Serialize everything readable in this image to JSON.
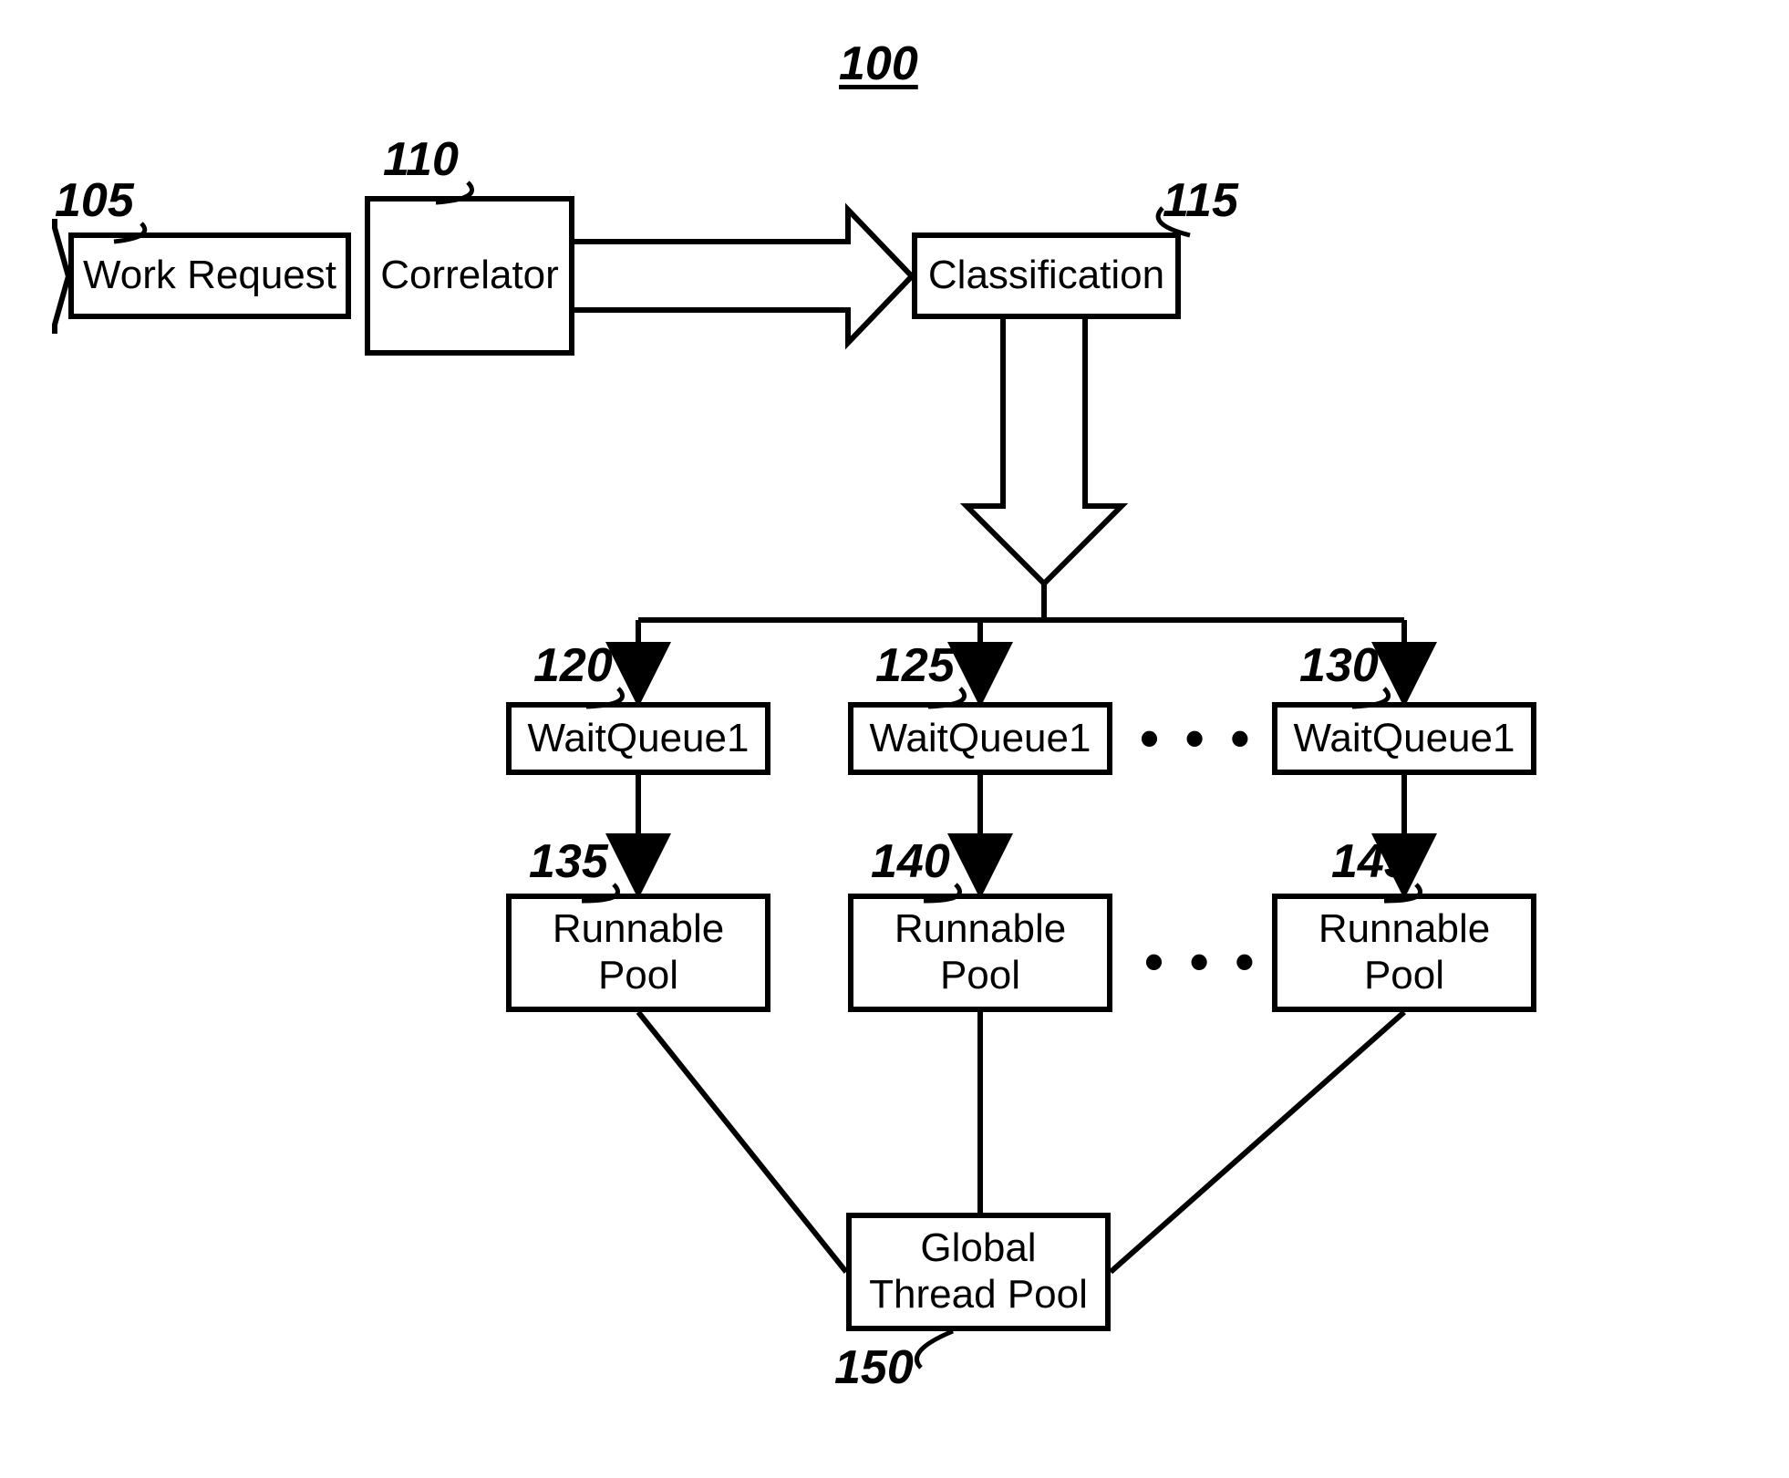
{
  "title": "100",
  "refs": {
    "r105": "105",
    "r110": "110",
    "r115": "115",
    "r120": "120",
    "r125": "125",
    "r130": "130",
    "r135": "135",
    "r140": "140",
    "r145": "145",
    "r150": "150"
  },
  "boxes": {
    "work_request": "Work Request",
    "correlator": "Correlator",
    "classification": "Classification",
    "wq1": "WaitQueue1",
    "wq2": "WaitQueue1",
    "wq3": "WaitQueue1",
    "rp1": "Runnable\nPool",
    "rp2": "Runnable\nPool",
    "rp3": "Runnable\nPool",
    "gtp": "Global\nThread Pool"
  },
  "ellipses": {
    "dots_wq": "• • •",
    "dots_rp": "• • •"
  }
}
